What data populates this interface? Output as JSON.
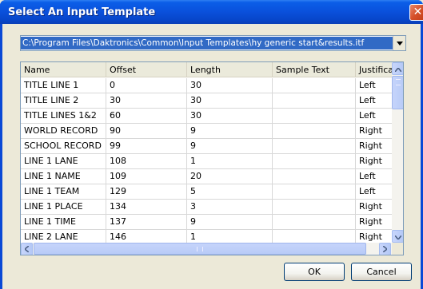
{
  "window": {
    "title": "Select An Input Template",
    "close_glyph": "✕"
  },
  "template_path": {
    "value": "C:\\Program Files\\Daktronics\\Common\\Input Templates\\hy generic start&results.itf"
  },
  "table": {
    "columns": [
      "Name",
      "Offset",
      "Length",
      "Sample Text",
      "Justificatio"
    ],
    "rows": [
      [
        "TITLE LINE 1",
        "0",
        "30",
        "",
        "Left"
      ],
      [
        "TITLE LINE 2",
        "30",
        "30",
        "",
        "Left"
      ],
      [
        "TITLE LINES 1&2",
        "60",
        "30",
        "",
        "Left"
      ],
      [
        "WORLD RECORD",
        "90",
        "9",
        "",
        "Right"
      ],
      [
        "SCHOOL RECORD",
        "99",
        "9",
        "",
        "Right"
      ],
      [
        "LINE 1 LANE",
        "108",
        "1",
        "",
        "Right"
      ],
      [
        "LINE 1 NAME",
        "109",
        "20",
        "",
        "Left"
      ],
      [
        "LINE 1 TEAM",
        "129",
        "5",
        "",
        "Left"
      ],
      [
        "LINE 1 PLACE",
        "134",
        "3",
        "",
        "Right"
      ],
      [
        "LINE 1 TIME",
        "137",
        "9",
        "",
        "Right"
      ],
      [
        "LINE 2 LANE",
        "146",
        "1",
        "",
        "Right"
      ]
    ]
  },
  "buttons": {
    "ok": "OK",
    "cancel": "Cancel"
  },
  "icons": {
    "combo_arrow": "chevron-down-icon",
    "scroll_up": "arrow-up-icon",
    "scroll_down": "arrow-down-icon",
    "scroll_left": "arrow-left-icon",
    "scroll_right": "arrow-right-icon"
  },
  "colors": {
    "titlebar": "#0a50db",
    "selection": "#316ac5",
    "close_button": "#d6502a"
  }
}
